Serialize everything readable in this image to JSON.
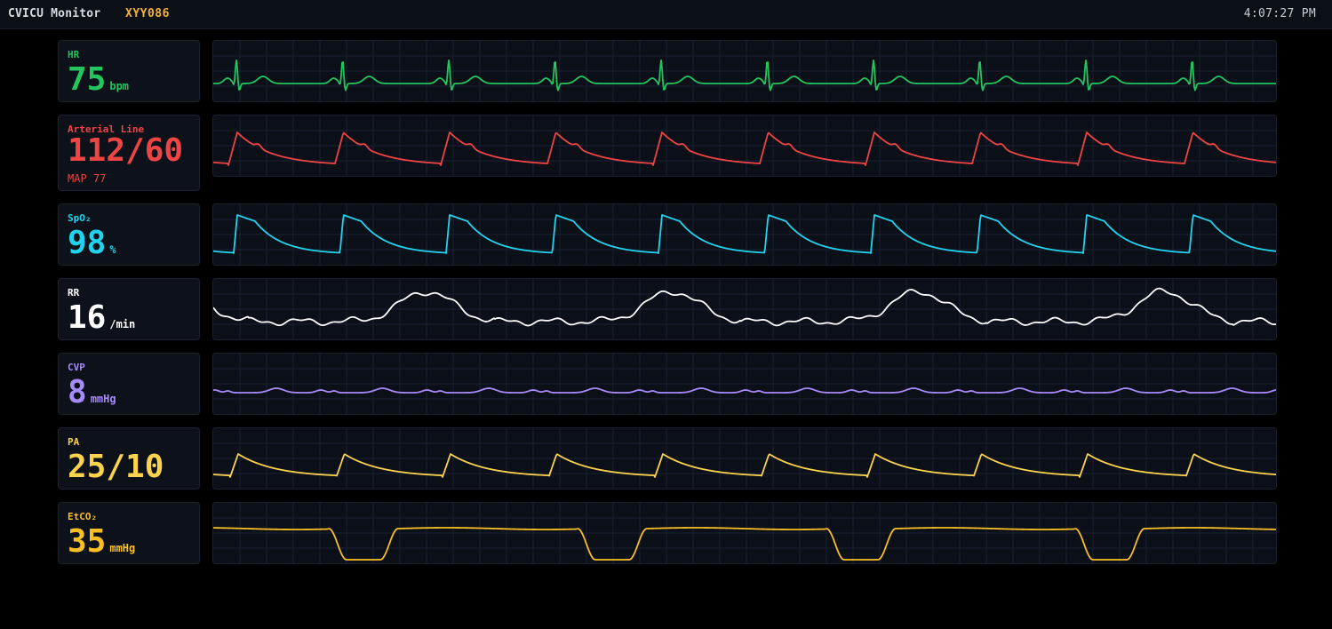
{
  "header": {
    "title": "CVICU Monitor",
    "patient_id": "XYY086",
    "patient_color": "#f5b13a",
    "clock": "4:07:27 PM"
  },
  "channels": [
    {
      "key": "hr",
      "label": "HR",
      "value": "75",
      "unit": "bpm",
      "color": "#22c55e",
      "waveform": "ecg"
    },
    {
      "key": "art",
      "label": "Arterial Line",
      "value": "112/60",
      "unit": "",
      "sub": "MAP 77",
      "color": "#ef4444",
      "waveform": "arterial"
    },
    {
      "key": "spo2",
      "label": "SpO₂",
      "value": "98",
      "unit": "%",
      "color": "#22d3ee",
      "waveform": "pleth"
    },
    {
      "key": "rr",
      "label": "RR",
      "value": "16",
      "unit": "/min",
      "color": "#ffffff",
      "waveform": "resp"
    },
    {
      "key": "cvp",
      "label": "CVP",
      "value": "8",
      "unit": "mmHg",
      "color": "#a78bfa",
      "waveform": "cvp"
    },
    {
      "key": "pa",
      "label": "PA",
      "value": "25/10",
      "unit": "",
      "color": "#fcd34d",
      "waveform": "pa"
    },
    {
      "key": "etco2",
      "label": "EtCO₂",
      "value": "35",
      "unit": "mmHg",
      "color": "#fbbf24",
      "waveform": "capno"
    }
  ]
}
